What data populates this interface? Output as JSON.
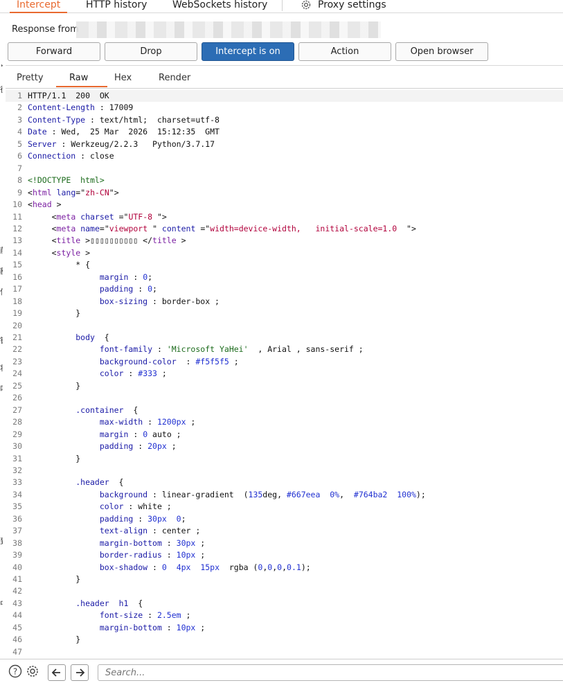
{
  "top_tabs": {
    "intercept": "Intercept",
    "http_history": "HTTP history",
    "websockets_history": "WebSockets history",
    "proxy_settings": "Proxy settings"
  },
  "response_label": "Response from",
  "toolbar": {
    "forward": "Forward",
    "drop": "Drop",
    "intercept_toggle": "Intercept is on",
    "action": "Action",
    "open_browser": "Open browser"
  },
  "view_tabs": {
    "pretty": "Pretty",
    "raw": "Raw",
    "hex": "Hex",
    "render": "Render"
  },
  "editor_lines": [
    {
      "n": "1",
      "segs": [
        [
          "c-plain",
          "HTTP/1.1  200  OK"
        ]
      ]
    },
    {
      "n": "2",
      "segs": [
        [
          "c-key",
          "Content-Length"
        ],
        [
          "c-plain",
          " : 17009"
        ]
      ]
    },
    {
      "n": "3",
      "segs": [
        [
          "c-key",
          "Content-Type"
        ],
        [
          "c-plain",
          " : text/html;  charset=utf-8"
        ]
      ]
    },
    {
      "n": "4",
      "segs": [
        [
          "c-key",
          "Date"
        ],
        [
          "c-plain",
          " : Wed,  25 Mar  2026  15:12:35  GMT"
        ]
      ]
    },
    {
      "n": "5",
      "segs": [
        [
          "c-key",
          "Server"
        ],
        [
          "c-plain",
          " : Werkzeug/2.2.3   Python/3.7.17"
        ]
      ]
    },
    {
      "n": "6",
      "segs": [
        [
          "c-key",
          "Connection"
        ],
        [
          "c-plain",
          " : close"
        ]
      ]
    },
    {
      "n": "7",
      "segs": []
    },
    {
      "n": "8",
      "segs": [
        [
          "c-str",
          "<!DOCTYPE  html>"
        ]
      ]
    },
    {
      "n": "9",
      "segs": [
        [
          "c-plain",
          "<"
        ],
        [
          "c-tag",
          "html"
        ],
        [
          "c-plain",
          " "
        ],
        [
          "c-attr",
          "lang"
        ],
        [
          "c-plain",
          "=\""
        ],
        [
          "c-val",
          "zh-CN"
        ],
        [
          "c-plain",
          "\">"
        ]
      ]
    },
    {
      "n": "10",
      "segs": [
        [
          "c-plain",
          "<"
        ],
        [
          "c-tag",
          "head"
        ],
        [
          "c-plain",
          " >"
        ]
      ]
    },
    {
      "n": "11",
      "segs": [
        [
          "c-plain",
          "     <"
        ],
        [
          "c-tag",
          "meta"
        ],
        [
          "c-plain",
          " "
        ],
        [
          "c-attr",
          "charset"
        ],
        [
          "c-plain",
          " =\""
        ],
        [
          "c-val",
          "UTF-8"
        ],
        [
          "c-plain",
          " \">"
        ]
      ]
    },
    {
      "n": "12",
      "segs": [
        [
          "c-plain",
          "     <"
        ],
        [
          "c-tag",
          "meta"
        ],
        [
          "c-plain",
          " "
        ],
        [
          "c-attr",
          "name"
        ],
        [
          "c-plain",
          "=\""
        ],
        [
          "c-val",
          "viewport"
        ],
        [
          "c-plain",
          " \" "
        ],
        [
          "c-attr",
          "content"
        ],
        [
          "c-plain",
          " =\""
        ],
        [
          "c-val",
          "width=device-width,   initial-scale=1.0"
        ],
        [
          "c-plain",
          "  \">"
        ]
      ]
    },
    {
      "n": "13",
      "segs": [
        [
          "c-plain",
          "     <"
        ],
        [
          "c-tag",
          "title"
        ],
        [
          "c-plain",
          " >▯▯▯▯▯▯▯▯▯▯ </"
        ],
        [
          "c-tag",
          "title"
        ],
        [
          "c-plain",
          " >"
        ]
      ]
    },
    {
      "n": "14",
      "segs": [
        [
          "c-plain",
          "     <"
        ],
        [
          "c-tag",
          "style"
        ],
        [
          "c-plain",
          " >"
        ]
      ]
    },
    {
      "n": "15",
      "segs": [
        [
          "c-plain",
          "          * {"
        ]
      ]
    },
    {
      "n": "16",
      "segs": [
        [
          "c-plain",
          "               "
        ],
        [
          "c-key",
          "margin"
        ],
        [
          "c-plain",
          " : "
        ],
        [
          "c-num",
          "0"
        ],
        [
          "c-plain",
          ";"
        ]
      ]
    },
    {
      "n": "17",
      "segs": [
        [
          "c-plain",
          "               "
        ],
        [
          "c-key",
          "padding"
        ],
        [
          "c-plain",
          " : "
        ],
        [
          "c-num",
          "0"
        ],
        [
          "c-plain",
          ";"
        ]
      ]
    },
    {
      "n": "18",
      "segs": [
        [
          "c-plain",
          "               "
        ],
        [
          "c-key",
          "box-sizing"
        ],
        [
          "c-plain",
          " : border-box ;"
        ]
      ]
    },
    {
      "n": "19",
      "segs": [
        [
          "c-plain",
          "          }"
        ]
      ]
    },
    {
      "n": "20",
      "segs": []
    },
    {
      "n": "21",
      "segs": [
        [
          "c-key",
          "          body"
        ],
        [
          "c-plain",
          "  {"
        ]
      ]
    },
    {
      "n": "22",
      "segs": [
        [
          "c-plain",
          "               "
        ],
        [
          "c-key",
          "font-family"
        ],
        [
          "c-plain",
          " : "
        ],
        [
          "c-str",
          "'Microsoft YaHei'"
        ],
        [
          "c-plain",
          "  , Arial , sans-serif ;"
        ]
      ]
    },
    {
      "n": "23",
      "segs": [
        [
          "c-plain",
          "               "
        ],
        [
          "c-key",
          "background-color"
        ],
        [
          "c-plain",
          "  : "
        ],
        [
          "c-num",
          "#f5f5f5"
        ],
        [
          "c-plain",
          " ;"
        ]
      ]
    },
    {
      "n": "24",
      "segs": [
        [
          "c-plain",
          "               "
        ],
        [
          "c-key",
          "color"
        ],
        [
          "c-plain",
          " : "
        ],
        [
          "c-num",
          "#333"
        ],
        [
          "c-plain",
          " ;"
        ]
      ]
    },
    {
      "n": "25",
      "segs": [
        [
          "c-plain",
          "          }"
        ]
      ]
    },
    {
      "n": "26",
      "segs": []
    },
    {
      "n": "27",
      "segs": [
        [
          "c-key",
          "          .container"
        ],
        [
          "c-plain",
          "  {"
        ]
      ]
    },
    {
      "n": "28",
      "segs": [
        [
          "c-plain",
          "               "
        ],
        [
          "c-key",
          "max-width"
        ],
        [
          "c-plain",
          " : "
        ],
        [
          "c-num",
          "1200px"
        ],
        [
          "c-plain",
          " ;"
        ]
      ]
    },
    {
      "n": "29",
      "segs": [
        [
          "c-plain",
          "               "
        ],
        [
          "c-key",
          "margin"
        ],
        [
          "c-plain",
          " : "
        ],
        [
          "c-num",
          "0"
        ],
        [
          "c-plain",
          " auto ;"
        ]
      ]
    },
    {
      "n": "30",
      "segs": [
        [
          "c-plain",
          "               "
        ],
        [
          "c-key",
          "padding"
        ],
        [
          "c-plain",
          " : "
        ],
        [
          "c-num",
          "20px"
        ],
        [
          "c-plain",
          " ;"
        ]
      ]
    },
    {
      "n": "31",
      "segs": [
        [
          "c-plain",
          "          }"
        ]
      ]
    },
    {
      "n": "32",
      "segs": []
    },
    {
      "n": "33",
      "segs": [
        [
          "c-key",
          "          .header"
        ],
        [
          "c-plain",
          "  {"
        ]
      ]
    },
    {
      "n": "34",
      "segs": [
        [
          "c-plain",
          "               "
        ],
        [
          "c-key",
          "background"
        ],
        [
          "c-plain",
          " : linear-gradient  ("
        ],
        [
          "c-num",
          "135"
        ],
        [
          "c-plain",
          "deg, "
        ],
        [
          "c-num",
          "#667eea"
        ],
        [
          "c-plain",
          "  "
        ],
        [
          "c-num",
          "0%"
        ],
        [
          "c-plain",
          ",  "
        ],
        [
          "c-num",
          "#764ba2"
        ],
        [
          "c-plain",
          "  "
        ],
        [
          "c-num",
          "100%"
        ],
        [
          "c-plain",
          ");"
        ]
      ]
    },
    {
      "n": "35",
      "segs": [
        [
          "c-plain",
          "               "
        ],
        [
          "c-key",
          "color"
        ],
        [
          "c-plain",
          " : white ;"
        ]
      ]
    },
    {
      "n": "36",
      "segs": [
        [
          "c-plain",
          "               "
        ],
        [
          "c-key",
          "padding"
        ],
        [
          "c-plain",
          " : "
        ],
        [
          "c-num",
          "30px"
        ],
        [
          "c-plain",
          "  "
        ],
        [
          "c-num",
          "0"
        ],
        [
          "c-plain",
          ";"
        ]
      ]
    },
    {
      "n": "37",
      "segs": [
        [
          "c-plain",
          "               "
        ],
        [
          "c-key",
          "text-align"
        ],
        [
          "c-plain",
          " : center ;"
        ]
      ]
    },
    {
      "n": "38",
      "segs": [
        [
          "c-plain",
          "               "
        ],
        [
          "c-key",
          "margin-bottom"
        ],
        [
          "c-plain",
          " : "
        ],
        [
          "c-num",
          "30px"
        ],
        [
          "c-plain",
          " ;"
        ]
      ]
    },
    {
      "n": "39",
      "segs": [
        [
          "c-plain",
          "               "
        ],
        [
          "c-key",
          "border-radius"
        ],
        [
          "c-plain",
          " : "
        ],
        [
          "c-num",
          "10px"
        ],
        [
          "c-plain",
          " ;"
        ]
      ]
    },
    {
      "n": "40",
      "segs": [
        [
          "c-plain",
          "               "
        ],
        [
          "c-key",
          "box-shadow"
        ],
        [
          "c-plain",
          " : "
        ],
        [
          "c-num",
          "0"
        ],
        [
          "c-plain",
          "  "
        ],
        [
          "c-num",
          "4px"
        ],
        [
          "c-plain",
          "  "
        ],
        [
          "c-num",
          "15px"
        ],
        [
          "c-plain",
          "  rgba ("
        ],
        [
          "c-num",
          "0"
        ],
        [
          "c-plain",
          ","
        ],
        [
          "c-num",
          "0"
        ],
        [
          "c-plain",
          ","
        ],
        [
          "c-num",
          "0"
        ],
        [
          "c-plain",
          ","
        ],
        [
          "c-num",
          "0.1"
        ],
        [
          "c-plain",
          ");"
        ]
      ]
    },
    {
      "n": "41",
      "segs": [
        [
          "c-plain",
          "          }"
        ]
      ]
    },
    {
      "n": "42",
      "segs": []
    },
    {
      "n": "43",
      "segs": [
        [
          "c-key",
          "          .header"
        ],
        [
          "c-plain",
          "  "
        ],
        [
          "c-key",
          "h1"
        ],
        [
          "c-plain",
          "  {"
        ]
      ]
    },
    {
      "n": "44",
      "segs": [
        [
          "c-plain",
          "               "
        ],
        [
          "c-key",
          "font-size"
        ],
        [
          "c-plain",
          " : "
        ],
        [
          "c-num",
          "2.5em"
        ],
        [
          "c-plain",
          " ;"
        ]
      ]
    },
    {
      "n": "45",
      "segs": [
        [
          "c-plain",
          "               "
        ],
        [
          "c-key",
          "margin-bottom"
        ],
        [
          "c-plain",
          " : "
        ],
        [
          "c-num",
          "10px"
        ],
        [
          "c-plain",
          " ;"
        ]
      ]
    },
    {
      "n": "46",
      "segs": [
        [
          "c-plain",
          "          }"
        ]
      ]
    },
    {
      "n": "47",
      "segs": []
    }
  ],
  "left_strip_chars": [
    "错",
    "径",
    "前",
    "额",
    "信",
    "针",
    "将",
    "叫",
    "到",
    "中"
  ],
  "search": {
    "placeholder": "Search..."
  }
}
